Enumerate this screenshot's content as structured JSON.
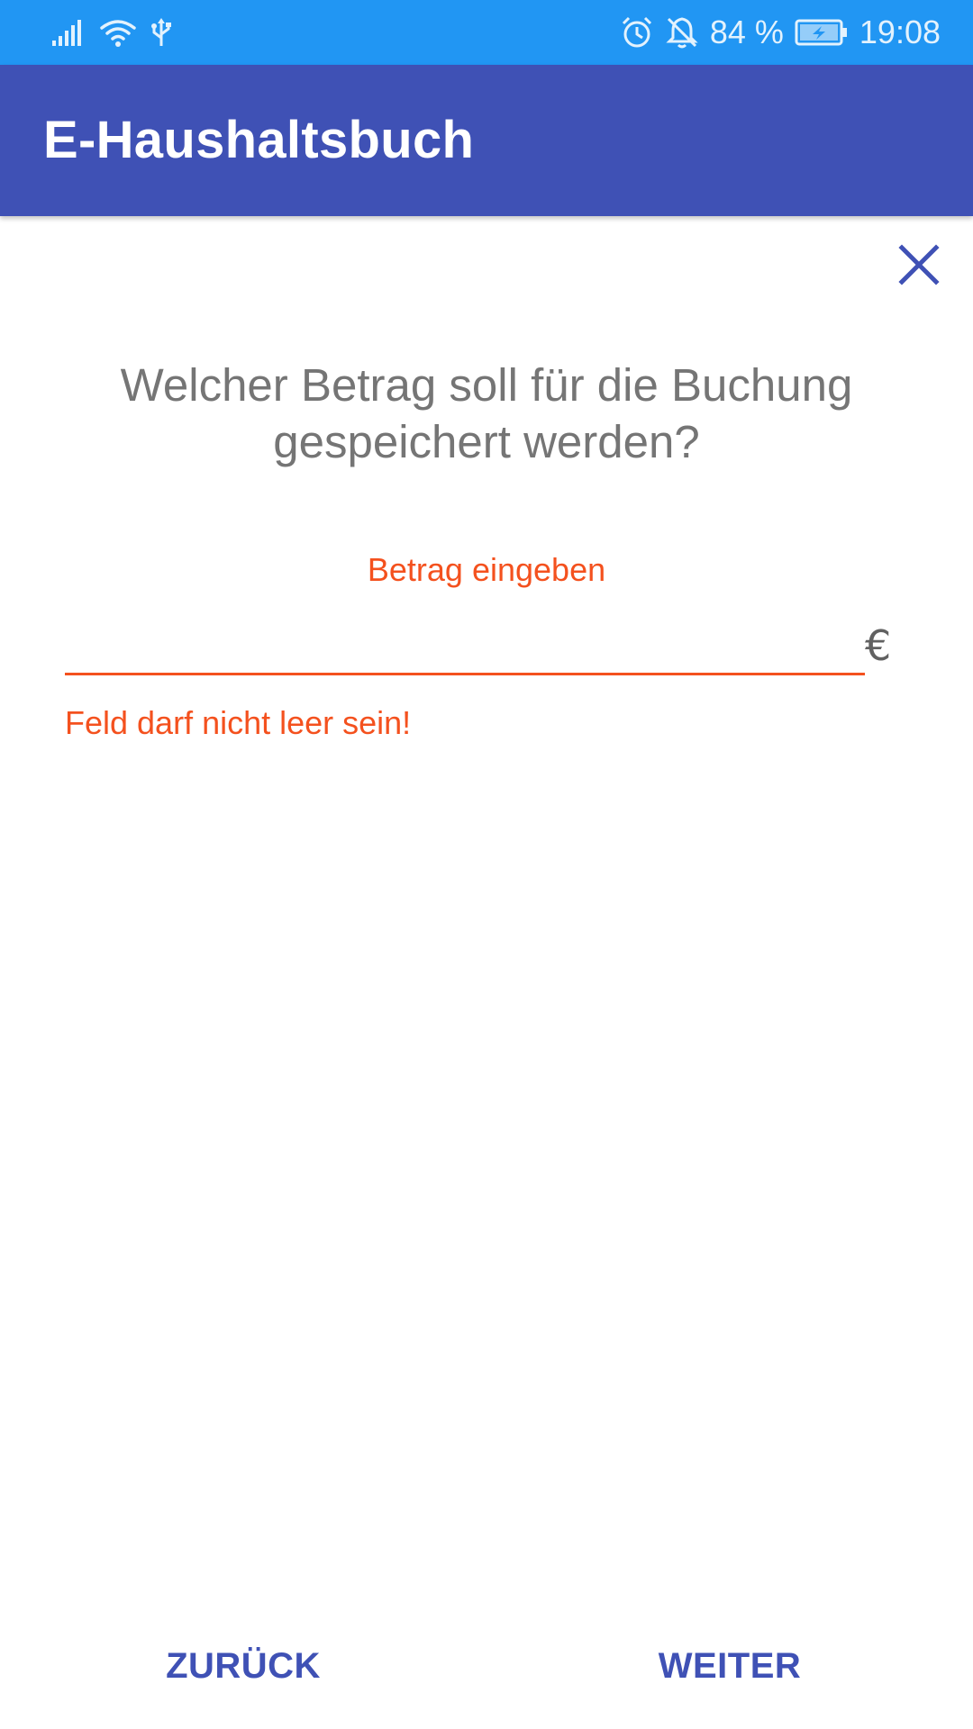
{
  "status_bar": {
    "battery_text": "84 %",
    "time": "19:08",
    "icons": [
      "signal-icon",
      "wifi-icon",
      "usb-icon",
      "alarm-icon",
      "notifications-off-icon",
      "battery-charging-icon"
    ]
  },
  "app_bar": {
    "title": "E-Haushaltsbuch"
  },
  "dialog": {
    "close_icon": "close-icon",
    "question": "Welcher Betrag soll für die Buchung gespeichert werden?",
    "amount_field": {
      "label": "Betrag eingeben",
      "value": "",
      "suffix": "€",
      "error": "Feld darf nicht leer sein!"
    },
    "back_label": "ZURÜCK",
    "next_label": "WEITER"
  },
  "colors": {
    "status_bar": "#2196f3",
    "app_bar": "#3f51b5",
    "accent": "#3f51b5",
    "error": "#f4511e",
    "question_text": "#757575"
  }
}
